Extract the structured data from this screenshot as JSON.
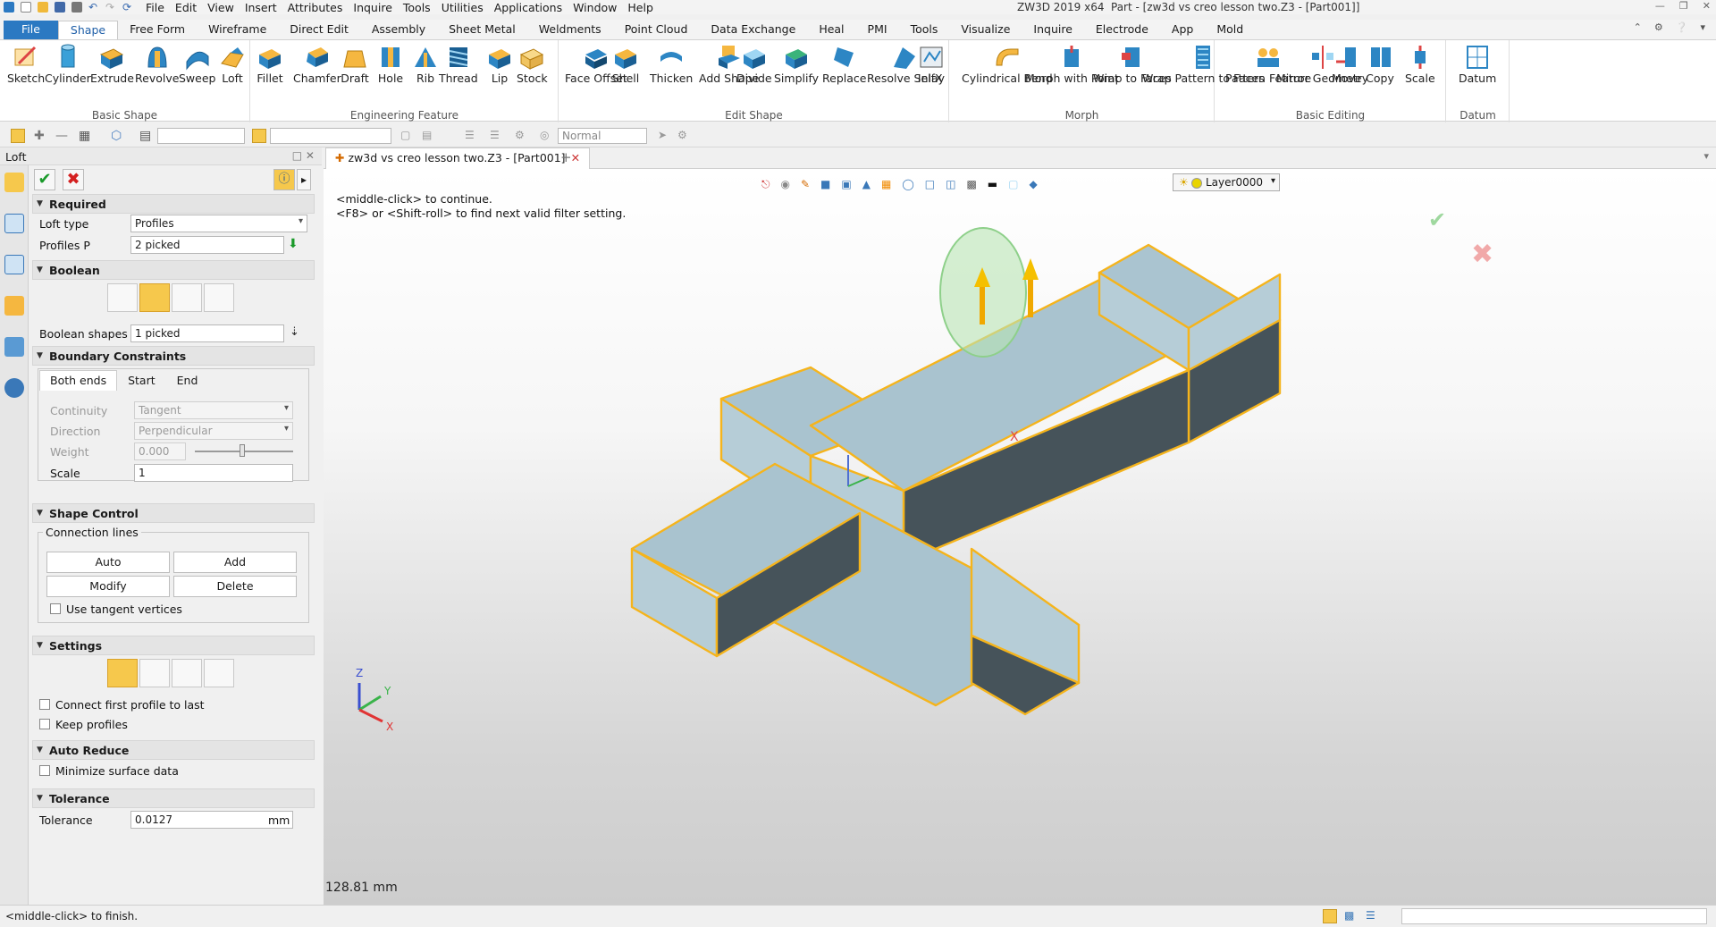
{
  "app_title": "ZW3D 2019  x64",
  "doc_title": "Part - [zw3d vs creo lesson two.Z3 - [Part001]]",
  "menu": [
    "File",
    "Edit",
    "View",
    "Insert",
    "Attributes",
    "Inquire",
    "Tools",
    "Utilities",
    "Applications",
    "Window",
    "Help"
  ],
  "ribbon_tabs": [
    "File",
    "Shape",
    "Free Form",
    "Wireframe",
    "Direct Edit",
    "Assembly",
    "Sheet Metal",
    "Weldments",
    "Point Cloud",
    "Data Exchange",
    "Heal",
    "PMI",
    "Tools",
    "Visualize",
    "Inquire",
    "Electrode",
    "App",
    "Mold"
  ],
  "active_tab": "Shape",
  "ribbon_groups": [
    {
      "label": "Basic Shape",
      "buttons": [
        "Sketch",
        "Cylinder",
        "Extrude",
        "Revolve",
        "Sweep",
        "Loft"
      ]
    },
    {
      "label": "Engineering Feature",
      "buttons": [
        "Fillet",
        "Chamfer",
        "Draft",
        "Hole",
        "Rib",
        "Thread",
        "Lip",
        "Stock"
      ]
    },
    {
      "label": "Edit Shape",
      "buttons": [
        "Face Offset",
        "Shell",
        "Thicken",
        "Add Shape",
        "Divide",
        "Simplify",
        "Replace",
        "Resolve SelfX",
        "Inlay"
      ]
    },
    {
      "label": "Morph",
      "buttons": [
        "Cylindrical Bend",
        "Morph with Point",
        "Wrap to Faces",
        "Wrap Pattern to Faces"
      ]
    },
    {
      "label": "Basic Editing",
      "buttons": [
        "Pattern Feature",
        "Mirror Geometry",
        "Move",
        "Copy",
        "Scale"
      ]
    },
    {
      "label": "Datum",
      "buttons": [
        "Datum"
      ]
    }
  ],
  "toolbar": {
    "filter_value": "Normal"
  },
  "panel": {
    "title": "Loft",
    "required": {
      "header": "Required",
      "loft_type_label": "Loft type",
      "loft_type_value": "Profiles",
      "profiles_label": "Profiles P",
      "profiles_value": "2 picked"
    },
    "boolean": {
      "header": "Boolean",
      "shapes_label": "Boolean shapes",
      "shapes_value": "1 picked"
    },
    "boundary": {
      "header": "Boundary Constraints",
      "tabs": [
        "Both ends",
        "Start",
        "End"
      ],
      "continuity_label": "Continuity",
      "continuity_value": "Tangent",
      "direction_label": "Direction",
      "direction_value": "Perpendicular",
      "weight_label": "Weight",
      "weight_value": "0.000",
      "scale_label": "Scale",
      "scale_value": "1"
    },
    "shape_control": {
      "header": "Shape Control",
      "group_label": "Connection lines",
      "auto": "Auto",
      "add": "Add",
      "modify": "Modify",
      "delete": "Delete",
      "tangent_vertices": "Use tangent vertices"
    },
    "settings": {
      "header": "Settings",
      "connect_first": "Connect first profile to last",
      "keep_profiles": "Keep profiles"
    },
    "auto_reduce": {
      "header": "Auto Reduce",
      "minimize": "Minimize surface data"
    },
    "tolerance": {
      "header": "Tolerance",
      "label": "Tolerance",
      "value": "0.0127",
      "unit": "mm"
    }
  },
  "viewport": {
    "tab_label": "zw3d vs creo lesson two.Z3 - [Part001]",
    "hint": "<middle-click> to continue.\n<F8> or <Shift-roll> to find next valid filter setting.",
    "layer": "Layer0000",
    "distance": "128.81 mm",
    "axis_labels": {
      "z": "Z",
      "y": "Y",
      "x": "X"
    }
  },
  "status_text": "<middle-click> to finish.",
  "colors": {
    "accent": "#2b79c2",
    "selection": "#f5b41c",
    "face": "#a9c3cf",
    "dark_face": "#46535a"
  }
}
